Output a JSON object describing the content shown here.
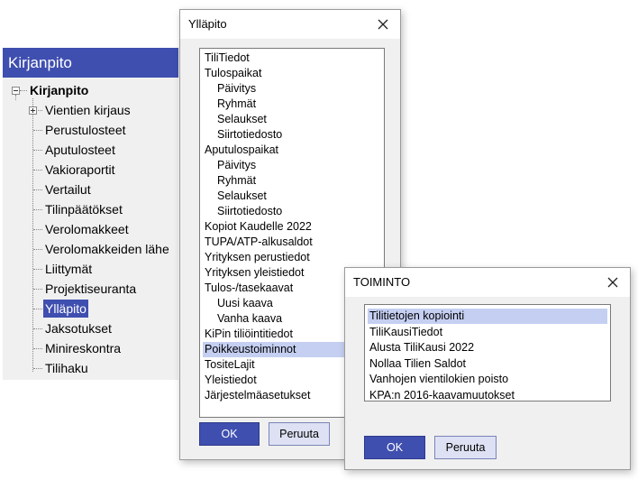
{
  "tree": {
    "header": "Kirjanpito",
    "root": "Kirjanpito",
    "items": [
      "Vientien kirjaus",
      "Perustulosteet",
      "Aputulosteet",
      "Vakioraportit",
      "Vertailut",
      "Tilinpäätökset",
      "Verolomakkeet",
      "Verolomakkeiden lähe",
      "Liittymät",
      "Projektiseuranta",
      "Ylläpito",
      "Jaksotukset",
      "Minireskontra",
      "Tilihaku"
    ],
    "selected": "Ylläpito"
  },
  "yllapito_dialog": {
    "title": "Ylläpito",
    "items": [
      "TiliTiedot",
      "Tulospaikat",
      "Päivitys",
      "Ryhmät",
      "Selaukset",
      "Siirtotiedosto",
      "Aputulospaikat",
      "Päivitys",
      "Ryhmät",
      "Selaukset",
      "Siirtotiedosto",
      "Kopiot Kaudelle 2022",
      "TUPA/ATP-alkusaldot",
      "Yrityksen perustiedot",
      "Yrityksen yleistiedot",
      "Tulos-/tasekaavat",
      "Uusi kaava",
      "Vanha kaava",
      "KiPin tiliöintitiedot",
      "Poikkeustoiminnot",
      "TositeLajit",
      "Yleistiedot",
      "Järjestelmäasetukset"
    ],
    "selected": "Poikkeustoiminnot",
    "ok_label": "OK",
    "cancel_label": "Peruuta"
  },
  "toiminto_dialog": {
    "title": "TOIMINTO",
    "items": [
      "Tilitietojen kopiointi",
      "TiliKausiTiedot",
      "Alusta TiliKausi 2022",
      "Nollaa Tilien Saldot",
      "Vanhojen vientilokien poisto",
      "KPA:n 2016-kaavamuutokset"
    ],
    "selected": "Tilitietojen kopiointi",
    "ok_label": "OK",
    "cancel_label": "Peruuta"
  },
  "colors": {
    "accent": "#3f4fb0",
    "selection": "#c5cff2",
    "panel": "#f0f0f0"
  }
}
